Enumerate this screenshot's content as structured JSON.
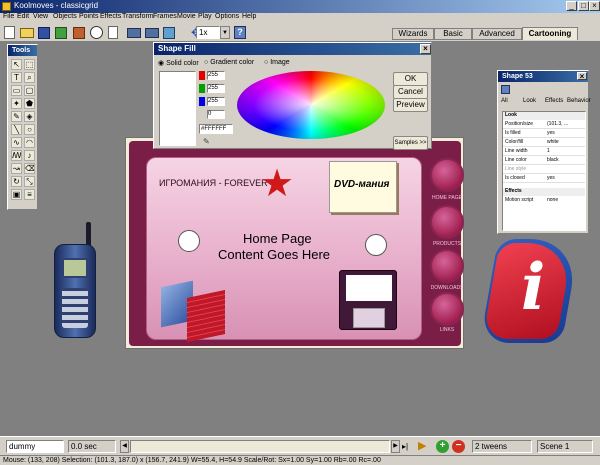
{
  "app": {
    "title": "Koolmoves - classicgrid"
  },
  "menu": [
    "File",
    "Edit",
    "View",
    "Objects",
    "Points",
    "Effects",
    "Transform",
    "Frames",
    "Movie",
    "Play",
    "Options",
    "Help"
  ],
  "toolbar": {
    "zoom_value": "1x"
  },
  "mode_tabs": [
    "Wizards",
    "Basic",
    "Advanced",
    "Cartooning"
  ],
  "tools_panel": {
    "title": "Tools"
  },
  "shape_fill": {
    "title": "Shape Fill",
    "options": [
      "Solid color",
      "Gradient color",
      "Image"
    ],
    "rgb": [
      "255",
      "255",
      "255"
    ],
    "alpha": "0",
    "hex": "#FFFFFF",
    "buttons": [
      "OK",
      "Cancel",
      "Preview"
    ],
    "samples": "Samples >>"
  },
  "shape_props": {
    "title": "Shape 53",
    "tabs": [
      "All",
      "Look",
      "Effects",
      "Behavior"
    ],
    "sections": {
      "look": "Look",
      "effects": "Effects"
    },
    "rows": [
      {
        "k": "Position/size",
        "v": "(101.3, ..."
      },
      {
        "k": "Is filled",
        "v": "yes"
      },
      {
        "k": "Color/fill",
        "v": "white"
      },
      {
        "k": "Line width",
        "v": "1"
      },
      {
        "k": "Line color",
        "v": "black"
      },
      {
        "k": "Line style",
        "v": ""
      },
      {
        "k": "Is closed",
        "v": "yes"
      }
    ],
    "effects_row": {
      "k": "Motion script",
      "v": "none"
    }
  },
  "stage": {
    "top_text": "HOME PAGE",
    "banner": "ИГРОМАНИЯ - FOREVER",
    "note": "DVD-мания",
    "content_line1": "Home Page",
    "content_line2": "Content Goes Here",
    "nav": [
      "HOME PAGE",
      "PRODUCTS",
      "DOWNLOADS",
      "LINKS"
    ],
    "colors": {
      "panel": "#7a1e48",
      "card": "#e8b8d0",
      "accent": "#c02050"
    }
  },
  "timeline": {
    "layer_name": "dummy",
    "time": "0.0 sec",
    "tweens": "2 tweens",
    "scene": "Scene 1"
  },
  "status": {
    "text": "Mouse: (133, 208)  Selection: (101.3, 187.0) x (156.7, 241.9)  W=55.4, H=54.9  Scale/Rot: Sx=1.00 Sy=1.00 Rb=.00 Rc=.00"
  }
}
